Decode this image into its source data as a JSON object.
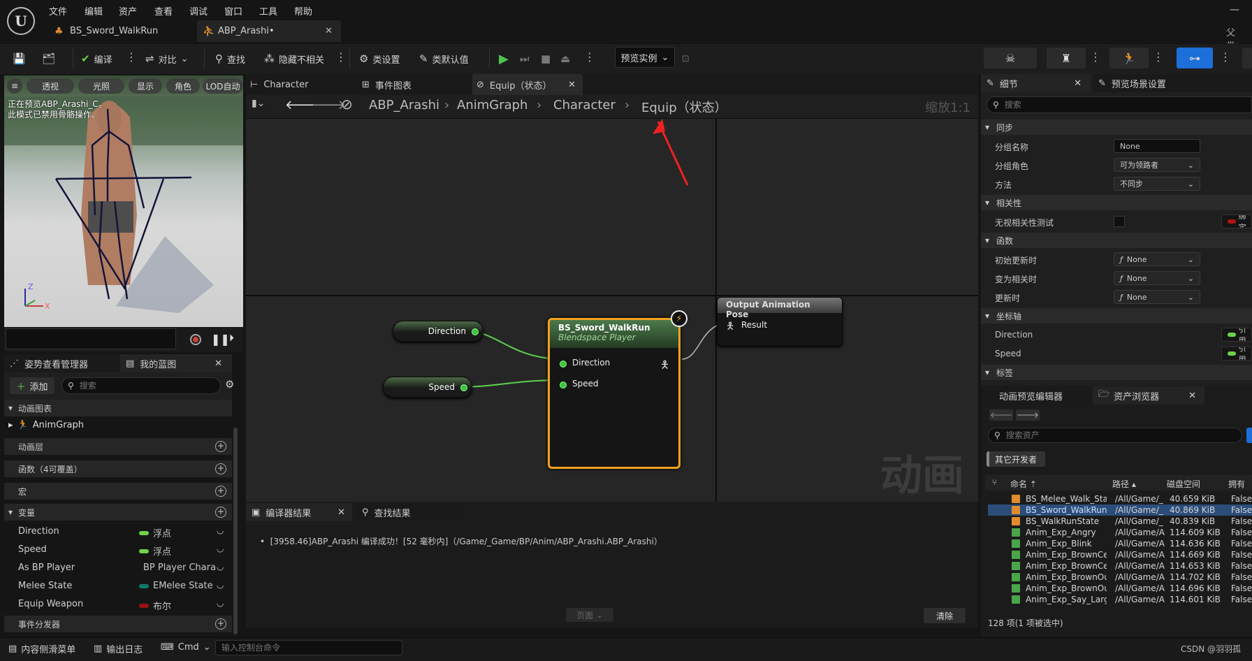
{
  "menu": [
    "文件",
    "编辑",
    "资产",
    "查看",
    "调试",
    "窗口",
    "工具",
    "帮助"
  ],
  "tabs": [
    {
      "label": "BS_Sword_WalkRun"
    },
    {
      "label": "ABP_Arashi•"
    }
  ],
  "parent_label": "父类：",
  "toolbar": {
    "compile": "编译",
    "diff": "对比",
    "find": "查找",
    "hide_unrelated": "隐藏不相关",
    "class_settings": "类设置",
    "class_defaults": "类默认值",
    "preview_instance": "预览实例"
  },
  "viewport": {
    "buttons": [
      "透视",
      "光照",
      "显示",
      "角色",
      "LOD自动"
    ],
    "info_line1": "正在预览ABP_Arashi_C。",
    "info_line2": "此模式已禁用骨骼操作。",
    "axis_z": "Z",
    "axis_x": "X"
  },
  "mybp": {
    "tab_pose": "姿势查看管理器",
    "tab_mybp": "我的蓝图",
    "add": "添加",
    "search_placeholder": "搜索",
    "sections": {
      "animgraph_hdr": "动画图表",
      "animgraph_item": "AnimGraph",
      "layers": "动画层",
      "functions": "函数（4可覆盖）",
      "macros": "宏",
      "variables": "变量",
      "dispatchers": "事件分发器"
    },
    "variables": [
      {
        "name": "Direction",
        "type": "浮点",
        "color": "#6fd14a"
      },
      {
        "name": "Speed",
        "type": "浮点",
        "color": "#6fd14a"
      },
      {
        "name": "As BP Player",
        "type": "BP Player Chara",
        "color": "#2aa7e8"
      },
      {
        "name": "Melee State",
        "type": "EMelee State",
        "color": "#0d7a6a"
      },
      {
        "name": "Equip Weapon",
        "type": "布尔",
        "color": "#9b1010"
      }
    ]
  },
  "graph_tabs": [
    "Character",
    "事件图表",
    "Equip（状态）"
  ],
  "breadcrumb": [
    "ABP_Arashi",
    "AnimGraph",
    "Character",
    "Equip（状态）"
  ],
  "zoom": "缩放1:1",
  "nodes": {
    "direction_var": "Direction",
    "speed_var": "Speed",
    "bs_title": "BS_Sword_WalkRun",
    "bs_subtitle": "Blendspace Player",
    "bs_pin_direction": "Direction",
    "bs_pin_speed": "Speed",
    "output_title": "Output Animation Pose",
    "output_pin": "Result"
  },
  "watermark": "动画",
  "compiler": {
    "tab": "编译器结果",
    "find_tab": "查找结果",
    "message": "[3958.46]ABP_Arashi 编译成功！[52 毫秒内]（/Game/_Game/BP/Anim/ABP_Arashi.ABP_Arashi）",
    "page": "页面",
    "clear": "清除"
  },
  "statusbar": {
    "content_drawer": "内容侧滑菜单",
    "output_log": "输出日志",
    "cmd": "Cmd",
    "console_placeholder": "输入控制台命令",
    "watermark": "CSDN @羽羽孤"
  },
  "details": {
    "tab": "细节",
    "tab2": "预览场景设置",
    "search_placeholder": "搜索",
    "cat_sync": "同步",
    "group_name_label": "分组名称",
    "group_name": "None",
    "group_role_label": "分组角色",
    "group_role": "可为领路者",
    "method_label": "方法",
    "method": "不同步",
    "cat_relevancy": "相关性",
    "ignore_label": "无视相关性测试",
    "bind": "绑定",
    "cat_functions": "函数",
    "init_label": "初始更新时",
    "relevant_label": "变为相关时",
    "update_label": "更新时",
    "fn_none": "None",
    "cat_axis": "坐标轴",
    "axis_dir": "Direction",
    "axis_speed": "Speed",
    "ref": "引用",
    "cat_tags": "标签"
  },
  "assets": {
    "tab1": "动画预览编辑器",
    "tab2": "资产浏览器",
    "search_placeholder": "搜索资产",
    "filter": "其它开发者",
    "columns": [
      "命名",
      "路径",
      "磁盘空间",
      "拥有"
    ],
    "rows": [
      {
        "name": "BS_Melee_Walk_Stat",
        "path": "/All/Game/_",
        "size": "40.659 KiB",
        "owner": "False"
      },
      {
        "name": "BS_Sword_WalkRun",
        "path": "/All/Game/_",
        "size": "40.869 KiB",
        "owner": "False"
      },
      {
        "name": "BS_WalkRunState",
        "path": "/All/Game/_",
        "size": "40.839 KiB",
        "owner": "False"
      },
      {
        "name": "Anim_Exp_Angry",
        "path": "/All/Game/A",
        "size": "114.609 KiB",
        "owner": "False"
      },
      {
        "name": "Anim_Exp_Blink",
        "path": "/All/Game/A",
        "size": "114.636 KiB",
        "owner": "False"
      },
      {
        "name": "Anim_Exp_BrownCen",
        "path": "/All/Game/A",
        "size": "114.669 KiB",
        "owner": "False"
      },
      {
        "name": "Anim_Exp_BrownCen",
        "path": "/All/Game/A",
        "size": "114.653 KiB",
        "owner": "False"
      },
      {
        "name": "Anim_Exp_BrownOut",
        "path": "/All/Game/A",
        "size": "114.702 KiB",
        "owner": "False"
      },
      {
        "name": "Anim_Exp_BrownOut",
        "path": "/All/Game/A",
        "size": "114.696 KiB",
        "owner": "False"
      },
      {
        "name": "Anim_Exp_Say_Large",
        "path": "/All/Game/A",
        "size": "114.601 KiB",
        "owner": "False"
      }
    ],
    "count": "128 项(1 项被选中)"
  }
}
